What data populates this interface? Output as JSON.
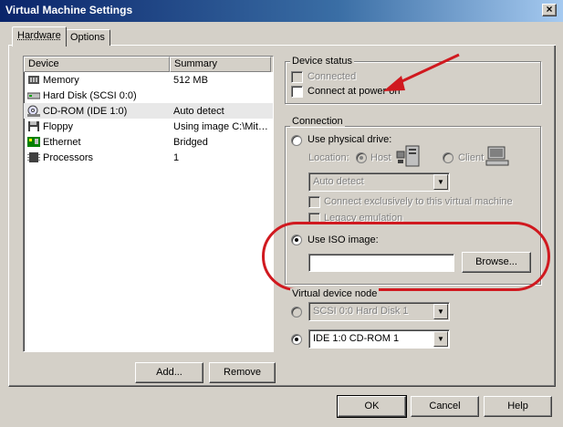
{
  "window": {
    "title": "Virtual Machine Settings",
    "close_glyph": "×"
  },
  "tabs": [
    {
      "label": "Hardware"
    },
    {
      "label": "Options"
    }
  ],
  "device_list": {
    "headers": {
      "device": "Device",
      "summary": "Summary"
    },
    "rows": [
      {
        "device": "Memory",
        "summary": "512 MB",
        "icon": "memory-icon"
      },
      {
        "device": "Hard Disk (SCSI 0:0)",
        "summary": "",
        "icon": "hard-disk-icon"
      },
      {
        "device": "CD-ROM (IDE 1:0)",
        "summary": "Auto detect",
        "icon": "cdrom-icon"
      },
      {
        "device": "Floppy",
        "summary": "Using image C:\\Mit…",
        "icon": "floppy-icon"
      },
      {
        "device": "Ethernet",
        "summary": "Bridged",
        "icon": "ethernet-icon"
      },
      {
        "device": "Processors",
        "summary": "1",
        "icon": "processor-icon"
      }
    ],
    "add_label": "Add...",
    "remove_label": "Remove"
  },
  "device_status": {
    "title": "Device status",
    "connected": {
      "label": "Connected",
      "checked": false,
      "enabled": false
    },
    "connect_at_power_on": {
      "label": "Connect at power on",
      "checked": false,
      "enabled": true
    }
  },
  "connection": {
    "title": "Connection",
    "use_physical_drive": {
      "label": "Use physical drive:",
      "selected": false
    },
    "location_label": "Location:",
    "host_label": "Host",
    "client_label": "Client",
    "drive_select": "Auto detect",
    "connect_exclusively": "Connect exclusively to this virtual machine",
    "legacy_emulation": "Legacy emulation",
    "use_iso": {
      "label": "Use ISO image:",
      "selected": true
    },
    "iso_path": "",
    "browse_label": "Browse..."
  },
  "virtual_device_node": {
    "title": "Virtual device node",
    "scsi_select": "SCSI 0:0   Hard Disk 1",
    "ide_select": "IDE 1:0   CD-ROM 1"
  },
  "footer": {
    "ok_label": "OK",
    "cancel_label": "Cancel",
    "help_label": "Help"
  },
  "colors": {
    "annotation_red": "#d0191f",
    "title_bar": "#0a246a",
    "dialog_bg": "#d4d0c8"
  }
}
